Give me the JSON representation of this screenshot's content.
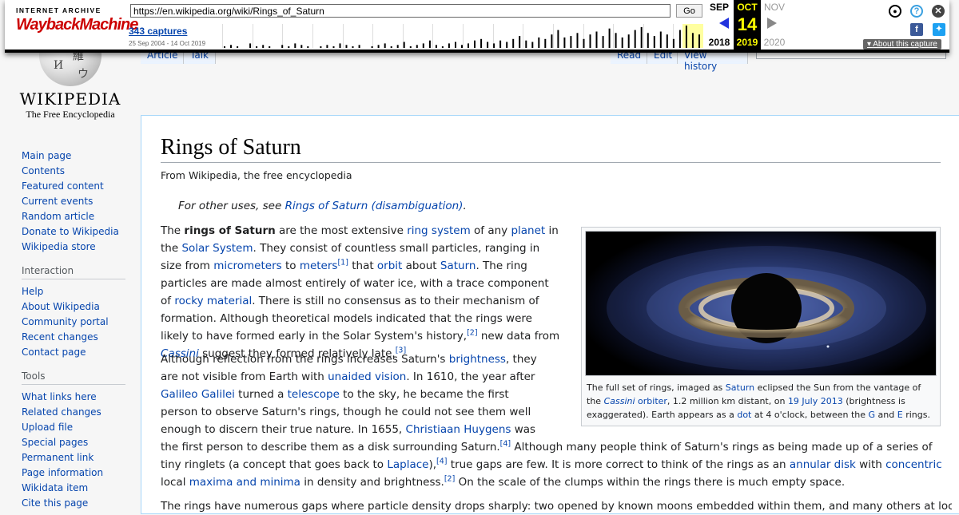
{
  "wayback": {
    "logo_top": "INTERNET ARCHIVE",
    "logo_main": "WaybackMachine",
    "url": "https://en.wikipedia.org/wiki/Rings_of_Saturn",
    "go_label": "Go",
    "captures": "343 captures",
    "date_range": "25 Sep 2004 - 14 Oct 2019",
    "prev_month": "SEP",
    "prev_year": "2018",
    "cur_month": "OCT",
    "cur_day": "14",
    "cur_year": "2019",
    "next_month": "NOV",
    "next_year": "2020",
    "about": "About this capture",
    "bars": [
      1,
      2,
      1,
      0,
      3,
      1,
      2,
      1,
      0,
      2,
      1,
      3,
      2,
      1,
      0,
      1,
      2,
      1,
      3,
      2,
      1,
      2,
      0,
      1,
      2,
      3,
      1,
      2,
      4,
      1,
      2,
      3,
      5,
      2,
      1,
      3,
      4,
      2,
      3,
      5,
      6,
      4,
      3,
      5,
      4,
      6,
      8,
      5,
      4,
      7,
      6,
      9,
      12,
      7,
      8,
      10,
      6,
      9,
      11,
      8,
      13,
      10,
      7,
      9,
      12,
      14,
      10,
      8,
      11,
      9,
      6,
      12,
      15,
      10,
      9
    ],
    "highlight_color": "#ffffa0"
  },
  "wiki": {
    "wordmark": "Wikipedia",
    "tagline": "The Free Encyclopedia",
    "globe_glyphs": [
      "Ω",
      "維",
      "И",
      "ウ"
    ],
    "tabs": [
      "Article",
      "Talk",
      "Read",
      "Edit",
      "View history"
    ],
    "sidebar_main": [
      "Main page",
      "Contents",
      "Featured content",
      "Current events",
      "Random article",
      "Donate to Wikipedia",
      "Wikipedia store"
    ],
    "interaction_heading": "Interaction",
    "sidebar_interaction": [
      "Help",
      "About Wikipedia",
      "Community portal",
      "Recent changes",
      "Contact page"
    ],
    "tools_heading": "Tools",
    "sidebar_tools": [
      "What links here",
      "Related changes",
      "Upload file",
      "Special pages",
      "Permanent link",
      "Page information",
      "Wikidata item",
      "Cite this page"
    ]
  },
  "article": {
    "title": "Rings of Saturn",
    "from": "From Wikipedia, the free encyclopedia",
    "hatnote_prefix": "For other uses, see ",
    "hatnote_link": "Rings of Saturn (disambiguation)",
    "hatnote_suffix": ".",
    "caption": {
      "t1": "The full set of rings, imaged as ",
      "l1": "Saturn",
      "t2": " eclipsed the Sun from the vantage of the ",
      "l2a": "Cassini",
      "l2b": " orbiter",
      "t3": ", 1.2 million km distant, on ",
      "l3": "19 July 2013",
      "t4": " (brightness is exaggerated). Earth appears as a ",
      "l4": "dot",
      "t5": " at 4 o'clock, between the ",
      "l5": "G",
      "t6": " and ",
      "l6": "E",
      "t7": " rings."
    },
    "p1": {
      "t0": "The ",
      "bold": "rings of Saturn",
      "t1": " are the most extensive ",
      "l1": "ring system",
      "t2": " of any ",
      "l2": "planet",
      "t3": " in the ",
      "l3": "Solar System",
      "t4": ". They consist of countless small particles, ranging in size from ",
      "l4": "micrometers",
      "t5": " to ",
      "l5": "meters",
      "s1": "[1]",
      "t6": " that ",
      "l6": "orbit",
      "t7": " about ",
      "l7": "Saturn",
      "t8": ". The ring particles are made almost entirely of water ice, with a trace component of ",
      "l8": "rocky material",
      "t9": ". There is still no consensus as to their mechanism of formation. Although theoretical models indicated that the rings were likely to have formed early in the Solar System's history,",
      "s2": "[2]",
      "t10": " new data from ",
      "l10": "Cassini",
      "t11": " suggest they formed relatively late.",
      "s3": "[3]"
    },
    "p2": {
      "t0": "Although reflection from the rings increases Saturn's ",
      "l1": "brightness",
      "t1": ", they are not visible from Earth with ",
      "l2": "unaided vision",
      "t2": ". In 1610, the year after ",
      "l3": "Galileo Galilei",
      "t3": " turned a ",
      "l4": "telescope",
      "t4": " to the sky, he became the first person to observe Saturn's rings, though he could not see them well enough to discern their true nature. In 1655, ",
      "l5": "Christiaan Huygens",
      "t5": " was the first person to describe them as a disk surrounding Saturn.",
      "s1": "[4]",
      "t6": " Although many people think of Saturn's rings as being made up of a series of tiny ringlets (a concept that goes back to ",
      "l6": "Laplace",
      "t7": "),",
      "s2": "[4]",
      "t8": " true gaps are few. It is more correct to think of the rings as an ",
      "l7": "annular disk",
      "t9": " with ",
      "l8": "concentric",
      "t10": " local ",
      "l9": "maxima and minima",
      "t11": " in density and brightness.",
      "s3": "[2]",
      "t12": " On the scale of the clumps within the rings there is much empty space."
    },
    "p3": "The rings have numerous gaps where particle density drops sharply: two opened by known moons embedded within them, and many others at locations"
  }
}
